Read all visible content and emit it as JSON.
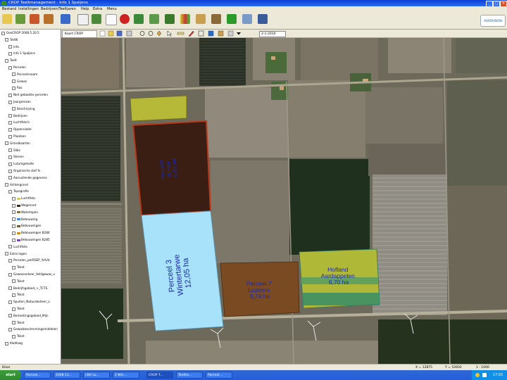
{
  "window": {
    "title": "CROP Teeltmanagement - Info 1 Spaljens",
    "controls": [
      "_",
      "□",
      "×"
    ]
  },
  "menu": [
    "Bestand",
    "Instellingen",
    "Bedrijven/Teeltjaren",
    "Help",
    "Extra",
    "Menu"
  ],
  "toolbar": {
    "icons": [
      "folder-icon",
      "tractor-icon",
      "barn-icon",
      "home-icon",
      "book-icon",
      "calendar-icon",
      "field-icon",
      "document-icon",
      "stop-icon",
      "settings-icon",
      "map-icon",
      "plant-icon",
      "chart-icon",
      "building-icon",
      "stack-icon",
      "leaf-icon",
      "photo-icon",
      "export-icon"
    ],
    "logo": "AGROVISION"
  },
  "tree": {
    "items": [
      {
        "label": "GeoCROP 2008.5.20.5",
        "indent": 0
      },
      {
        "label": "TeVW",
        "indent": 1
      },
      {
        "label": "Info",
        "indent": 2
      },
      {
        "label": "Info 1 Spaljens",
        "indent": 2
      },
      {
        "label": "Teelt",
        "indent": 1
      },
      {
        "label": "Percelen",
        "indent": 2
      },
      {
        "label": "Perceelsnaam",
        "indent": 3
      },
      {
        "label": "Gewas",
        "indent": 3
      },
      {
        "label": "Ras",
        "indent": 3
      },
      {
        "label": "Niet geboekte percelen",
        "indent": 2
      },
      {
        "label": "Jaargrenzen",
        "indent": 2
      },
      {
        "label": "Beschrijving",
        "indent": 3
      },
      {
        "label": "Bedrijven",
        "indent": 2
      },
      {
        "label": "Luchtfoto's",
        "indent": 2
      },
      {
        "label": "Opperviakte",
        "indent": 2
      },
      {
        "label": "Plaatsen",
        "indent": 2
      },
      {
        "label": "Grondkaarten",
        "indent": 1
      },
      {
        "label": "Slibs",
        "indent": 2
      },
      {
        "label": "Stenen",
        "indent": 2
      },
      {
        "label": "Lutumgehalte",
        "indent": 2
      },
      {
        "label": "Organische stof %",
        "indent": 2
      },
      {
        "label": "Aanvullende gegevens",
        "indent": 2
      },
      {
        "label": "Achtergrond",
        "indent": 1
      },
      {
        "label": "Topografie",
        "indent": 2
      },
      {
        "label": "Luchtfoto",
        "indent": 3
      },
      {
        "label": "Wegennet",
        "indent": 3
      },
      {
        "label": "Waterlopen",
        "indent": 3
      },
      {
        "label": "Bebouwing",
        "indent": 3
      },
      {
        "label": "Bebouwingen",
        "indent": 3
      },
      {
        "label": "Bebouwingen B284",
        "indent": 3
      },
      {
        "label": "Bebouwingen B285",
        "indent": 3
      },
      {
        "label": "Luchtfoto",
        "indent": 2
      },
      {
        "label": "Extra lagen",
        "indent": 1
      },
      {
        "label": "Percelen_perRSEP_%%%",
        "indent": 2
      },
      {
        "label": "Tekst",
        "indent": 3
      },
      {
        "label": "Gewasverkeer_Veldgewas_v",
        "indent": 2
      },
      {
        "label": "Tekst",
        "indent": 3
      },
      {
        "label": "Bedrijfsgebied_+_TCTS",
        "indent": 2
      },
      {
        "label": "Tekst",
        "indent": 3
      },
      {
        "label": "Spuiten_Natuurbeheer_v",
        "indent": 2
      },
      {
        "label": "Tekst",
        "indent": 3
      },
      {
        "label": "Bemestingsgebied_Mijn",
        "indent": 2
      },
      {
        "label": "Tekst",
        "indent": 3
      },
      {
        "label": "Gewasbeschermingsmiddelen",
        "indent": 2
      },
      {
        "label": "Tekst",
        "indent": 3
      },
      {
        "label": "Kladlaag",
        "indent": 1
      }
    ],
    "swatch_colors": [
      "#d9cf3a",
      "#3a2a1a",
      "#8a6f45",
      "#4a88d8",
      "#6b5a3a",
      "#c78f2a",
      "#7a4ca6",
      "#0a0a0a"
    ]
  },
  "map": {
    "tab": "Kaart CROP",
    "date": "2-1-2010",
    "plots": [
      {
        "lines": [
          "Perceel 3",
          "Wintertarwe",
          "12,05 ha"
        ],
        "fill": "#a8e1fa"
      },
      {
        "lines": [
          "Perceel 7",
          "Luzerne",
          "6,74 ha"
        ],
        "fill": "#7a4a22"
      },
      {
        "lines": [
          "Hofland",
          "Aardappelen",
          "6,70 ha"
        ],
        "fill": "#b0b838"
      },
      {
        "lines": [
          "Perceel",
          "Winter",
          "6,83 ha"
        ],
        "fill": "#3a1e14"
      }
    ]
  },
  "status": {
    "left": "Klaar",
    "x": "X = 12875",
    "y": "Y = 52602",
    "zoom": "1 : 1000"
  },
  "taskbar": {
    "start": "start",
    "tasks": [
      "Perceel...",
      "2008-11...",
      "LNV Lo...",
      "2 Win...",
      "CROP T...",
      "Teeltre...",
      "Perceel..."
    ],
    "clock": "17:01"
  }
}
